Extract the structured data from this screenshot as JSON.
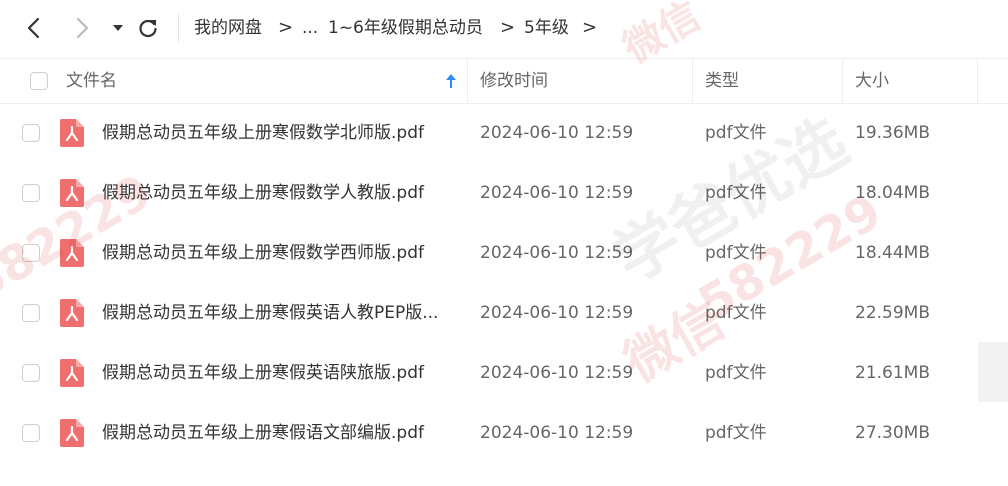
{
  "breadcrumb": {
    "root": "我的网盘",
    "ellipsis": "...",
    "parent": "1~6年级假期总动员",
    "current": "5年级",
    "separator": ">"
  },
  "columns": {
    "name": "文件名",
    "modified": "修改时间",
    "type": "类型",
    "size": "大小"
  },
  "files": [
    {
      "name": "假期总动员五年级上册寒假数学北师版.pdf",
      "modified": "2024-06-10 12:59",
      "type": "pdf文件",
      "size": "19.36MB"
    },
    {
      "name": "假期总动员五年级上册寒假数学人教版.pdf",
      "modified": "2024-06-10 12:59",
      "type": "pdf文件",
      "size": "18.04MB"
    },
    {
      "name": "假期总动员五年级上册寒假数学西师版.pdf",
      "modified": "2024-06-10 12:59",
      "type": "pdf文件",
      "size": "18.44MB"
    },
    {
      "name": "假期总动员五年级上册寒假英语人教PEP版...",
      "modified": "2024-06-10 12:59",
      "type": "pdf文件",
      "size": "22.59MB"
    },
    {
      "name": "假期总动员五年级上册寒假英语陕旅版.pdf",
      "modified": "2024-06-10 12:59",
      "type": "pdf文件",
      "size": "21.61MB"
    },
    {
      "name": "假期总动员五年级上册寒假语文部编版.pdf",
      "modified": "2024-06-10 12:59",
      "type": "pdf文件",
      "size": "27.30MB"
    }
  ],
  "watermarks": {
    "text_a": "学爸优选",
    "text_b": "微信",
    "text_c": "582229"
  },
  "colors": {
    "accent": "#2f8cff",
    "pdf_icon": "#f06e6e"
  }
}
